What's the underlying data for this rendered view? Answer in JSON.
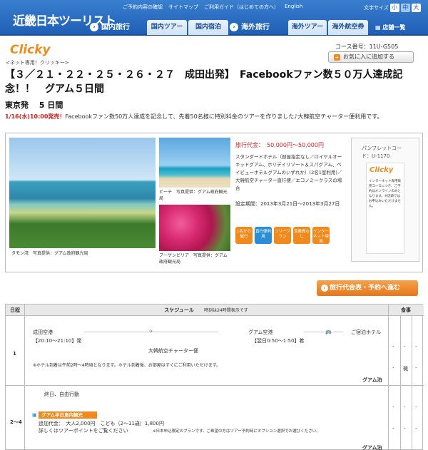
{
  "header": {
    "logo": "近畿日本ツーリスト",
    "links": [
      "ご予約内容の確認",
      "サイトマップ",
      "ご利用ガイド（はじめての方へ）",
      "English"
    ],
    "font_size_label": "文字サイズ",
    "font_sizes": [
      "小",
      "中",
      "大"
    ],
    "nav_domestic": "国内旅行",
    "tab_domestic_tour": "国内ツアー",
    "tab_domestic_hotel": "国内宿泊",
    "nav_overseas": "海外旅行",
    "tab_overseas_tour": "海外ツアー",
    "tab_overseas_air": "海外航空券",
    "nav_stores": "店舗一覧"
  },
  "brand": {
    "name": "Clicky",
    "sub": "<ネット専用！クリッキー>",
    "course_code": "コース番号：11U-G505",
    "favorite_button": "お気に入に追加する"
  },
  "title": "【３／２１・２２・２５・２６・２７　成田出発】　Facebookファン数５０万人達成記念！！　グアム５日間",
  "depart": "東京発　 5 日間",
  "notice_date": "1/16(水)10:00発売！",
  "notice_text": "Facebookファン数50万人達成を記念して、先着50名様に特別料金のツアーを作りました♪大韓航空チャーター便利用です。",
  "photos": {
    "cap1": "タモン湾　写真提供：グアム政府観光局",
    "cap2": "ビーチ　写真提供：グアム政府観光局",
    "cap3": "ブーゲンビリア　写真提供：グアム政府観光局"
  },
  "info": {
    "price": "旅行代金：　50,000円〜50,000円",
    "hotels": "スタンダードホテル（部屋指定なし／ロイヤルオーキッドグアム、ホリデイリゾート＆スパグアム、ベイビューホテルグアムのいずれか）(2名1室利用)／大韓航空チャーター直行便／エコノミークラスの場合",
    "period": "設定期間：2013年3月21日〜2013年3月27日",
    "icons": [
      "1名から催行",
      "直行便利用",
      "フリープラン",
      "添乗員なし",
      "インターネット専用"
    ]
  },
  "pamphlet": {
    "code": "パンフレットコード：U-1170",
    "card_name": "Clicky",
    "card_text": "インターネット専用販売コースにつき、ご予約はオンラインのみとなります。※店頭ではお申込みいただけません。"
  },
  "reserve_button": "旅行代金表・予約へ進む",
  "schedule": {
    "headers": {
      "day": "日程",
      "schedule": "スケジュール",
      "note": "時刻は24時間表示です",
      "meals": "食事"
    },
    "day1": {
      "day": "1",
      "from": "成田空港",
      "to": "グアム空港",
      "hotel": "ご宿泊ホテル",
      "dep_time": "【20:10〜21:10】発",
      "arr_time": "【翌日0:50〜1:50】着",
      "flight": "大韓航空チャーター便",
      "hotel_note": "※ホテル到着は午前2時〜4時頃となります。ホテル到着後、お部屋はすぐにご利用いただけます。",
      "meal_mid": "機",
      "stay": "グアム泊"
    },
    "day2": {
      "day": "2〜4",
      "activity": "終日、自由行動",
      "optional_tour": "グアム半日島内観光",
      "optional_price": "追加代金：　大人2,000円　こども（2〜11歳）1,800円",
      "optional_detail": "詳しくはツアーポイントをご覧ください",
      "optional_note": "※日本申込限定のプランです。ご希望の方はツアー予約時にオプション選択でお選びください。",
      "stay": "グアム泊"
    },
    "dash": "-"
  }
}
